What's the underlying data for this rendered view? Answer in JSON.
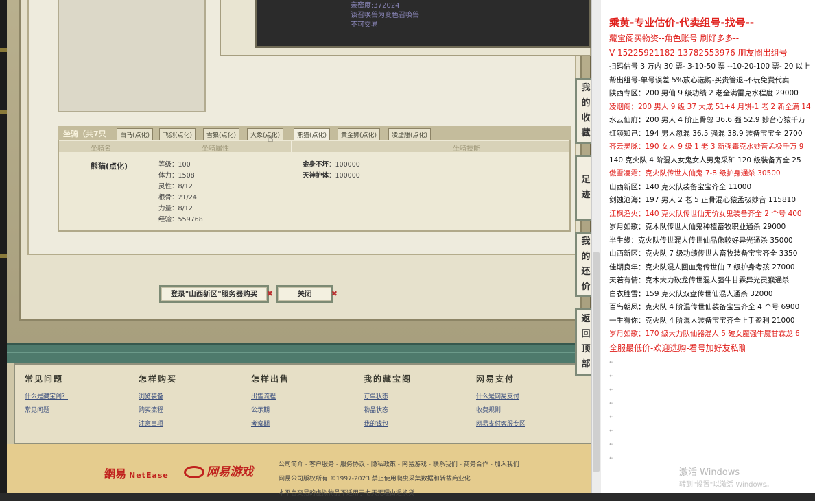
{
  "dark_panel_lines": [
    "亲密度:372024",
    "该召唤兽为变色召唤兽",
    "不可交易"
  ],
  "mount": {
    "section_title": "坐骑（共7只",
    "tabs": [
      "白马(点化)",
      "飞剑(点化)",
      "雪狼(点化)",
      "大象(点化)",
      "熊猫(点化)",
      "黄金狮(点化)",
      "凌虚雕(点化)"
    ],
    "col_name": "坐骑名",
    "col_attr": "坐骑属性",
    "col_skill": "坐骑技能",
    "name": "熊猫(点化)",
    "attrs": [
      "等级：100",
      "体力：1508",
      "灵性：8/12",
      "根骨：21/24",
      "力量：8/12",
      "经验：559768"
    ],
    "skills": [
      {
        "name": "金身不坏",
        "value": "：100000"
      },
      {
        "name": "天神护体",
        "value": "：100000"
      }
    ]
  },
  "buttons": {
    "login": "登录\"山西新区\"服务器购买",
    "close": "关闭",
    "x_mark": "✖"
  },
  "side_buttons": {
    "favorites": [
      "我",
      "的",
      "收",
      "藏"
    ],
    "footprint": [
      "足",
      "迹"
    ],
    "bargain": [
      "我",
      "的",
      "还",
      "价"
    ],
    "top": [
      "返",
      "回",
      "顶",
      "部"
    ]
  },
  "footer": {
    "cols": [
      {
        "title": "常见问题",
        "links": [
          "什么是藏宝阁？",
          "常见问题"
        ]
      },
      {
        "title": "怎样购买",
        "links": [
          "浏览装备",
          "购买流程",
          "注意事项"
        ]
      },
      {
        "title": "怎样出售",
        "links": [
          "出售流程",
          "公示期",
          "考察期"
        ]
      },
      {
        "title": "我的藏宝阁",
        "links": [
          "订单状态",
          "物品状态",
          "我的钱包"
        ]
      },
      {
        "title": "网易支付",
        "links": [
          "什么是网易支付",
          "收费规则",
          "网易支付客服专区"
        ]
      }
    ]
  },
  "bottom": {
    "netease": "網易",
    "netease_en": "NetEase",
    "game_logo": "网易游戏",
    "links_line1": "公司简介 - 客户服务 - 服务协议 - 隐私政策 - 网易游戏 - 联系我们 - 商务合作 - 加入我们",
    "links_line2": "网易公司版权所有 ©1997-2023 禁止使用爬虫采集数据和转载商业化",
    "links_line3": "本平台交易的虚拟物品不适用于七天无理由退换货"
  },
  "right_panel": {
    "title": "乘黄-专业估价-代卖组号-找号--",
    "lines": [
      {
        "text": "藏宝阁买物资--角色账号 刷好多多--",
        "red": true,
        "big": true
      },
      {
        "text": "V 15225921182   13782553976  朋友圈出组号",
        "red": true,
        "big": true
      },
      {
        "text": "扫码估号 3 万内 30 票- 3-10-50 票  --10-20-100 票- 20 以上",
        "red": false
      },
      {
        "text": "帮出组号-单号误差 5%放心选购-买贵管退-不玩免费代卖",
        "red": false
      },
      {
        "text": "陕西专区：200 男仙 9 级功绩 2 老全满雷克水程度 29000",
        "red": false
      },
      {
        "text": "凌烟阁：200 男人 9 级 37 大成 51+4 月饼-1 老 2 新全满 14",
        "red": true
      },
      {
        "text": "水云仙府：200 男人 4 阶正骨忽 36.6 强 52.9 妙音心猿千万",
        "red": false
      },
      {
        "text": "红颜知己：194 男人忽混 36.5 强混 38.9 装备宝宝全 2700",
        "red": false
      },
      {
        "text": "齐云灵脉：190 女人 9 级 1 老 3 新强毒克水妙音孟极千万 9",
        "red": true
      },
      {
        "text": "140 克火队 4 阶混人女鬼女人男鬼采矿 120 级装备齐全 25",
        "red": false
      },
      {
        "text": "傲雪凌霜：克火队传世人仙鬼 7-8 级护身通杀 30500",
        "red": true
      },
      {
        "text": "山西新区：140 克火队装备宝宝齐全 11000",
        "red": false
      },
      {
        "text": "剑蚀沧海：197 男人 2 老 5 正骨混心猿孟极妙音 115810",
        "red": false
      },
      {
        "text": "江枫渔火：140 克火队传世仙无价女鬼装备齐全 2 个号 400",
        "red": true
      },
      {
        "text": "岁月如歌：克木队传世人仙鬼种植畜牧职业通杀 29000",
        "red": false
      },
      {
        "text": "半生缘：克火队传世混人传世仙品像较好异光通杀 35000",
        "red": false
      },
      {
        "text": "山西新区：克火队 7 级功绩传世人畜牧装备宝宝齐全 3350",
        "red": false
      },
      {
        "text": "佳期良年：克火队混人回血鬼传世仙 7 级护身考孩 27000",
        "red": false
      },
      {
        "text": "天若有情：克木大力砍龙传世混人强牛甘霖异光灵猴通杀",
        "red": false
      },
      {
        "text": "白衣胜雪：159 克火队双盘传世仙混人通杀 32000",
        "red": false
      },
      {
        "text": "百鸟朝凤：克火队 4 阶混传世仙装备宝宝齐全 4 个号 6900",
        "red": false
      },
      {
        "text": "一生有你：克火队 4 阶混人装备宝宝齐全上手盈利 21000",
        "red": false
      },
      {
        "text": "岁月如歌：170 级大力队仙器混人 5 破女魔强牛魔甘霖龙 6",
        "red": true
      },
      {
        "text": "全服最低价-欢迎选购-看号加好友私聊",
        "red": true,
        "big": true
      }
    ],
    "return_mark": "↵"
  },
  "windows_watermark": {
    "line1": "激活 Windows",
    "line2": "转到\"设置\"以激活 Windows。"
  }
}
